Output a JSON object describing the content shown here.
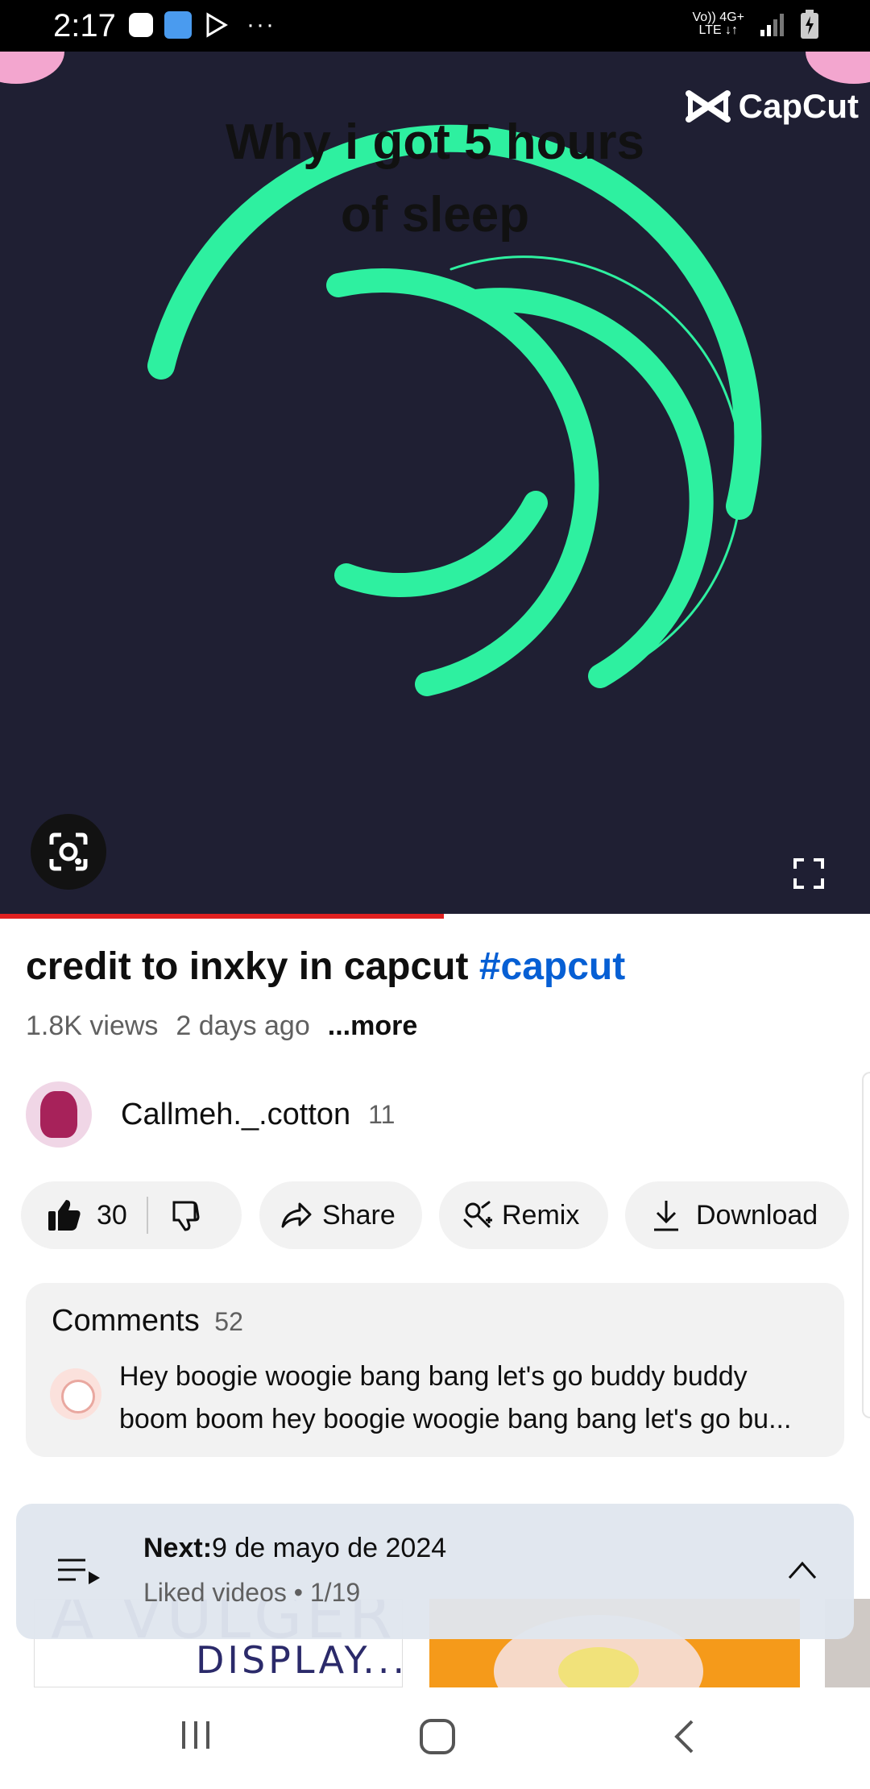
{
  "status_bar": {
    "time": "2:17",
    "network_top": "Vo)) 4G+",
    "network_bottom": "LTE ↓↑",
    "more_dots": "···"
  },
  "video": {
    "overlay_line1": "Why i got 5 hours",
    "overlay_line2": "of sleep",
    "watermark": "CapCut",
    "progress_fraction": 0.51,
    "accent_color": "#2ef0a0"
  },
  "details": {
    "title": "credit to inxky in capcut",
    "hashtag": "#capcut",
    "views": "1.8K views",
    "age": "2 days ago",
    "more_label": "...more"
  },
  "channel": {
    "name": "Callmeh._.cotton",
    "subscribers": "11"
  },
  "actions": {
    "likes": "30",
    "share_label": "Share",
    "remix_label": "Remix",
    "download_label": "Download"
  },
  "comments": {
    "label": "Comments",
    "count": "52",
    "top_comment": "Hey boogie woogie bang bang let's go buddy buddy boom boom hey boogie woogie bang bang let's go bu..."
  },
  "playlist": {
    "next_label": "Next:",
    "next_title": "9 de mayo de 2024",
    "subtitle": "Liked videos • 1/19"
  },
  "thumbnails": {
    "first_line1": "A VULGER",
    "first_line2": "DISPLAY..."
  },
  "colors": {
    "link_blue": "#065fd4",
    "progress_red": "#e02020",
    "video_bg": "#1f1f33"
  }
}
